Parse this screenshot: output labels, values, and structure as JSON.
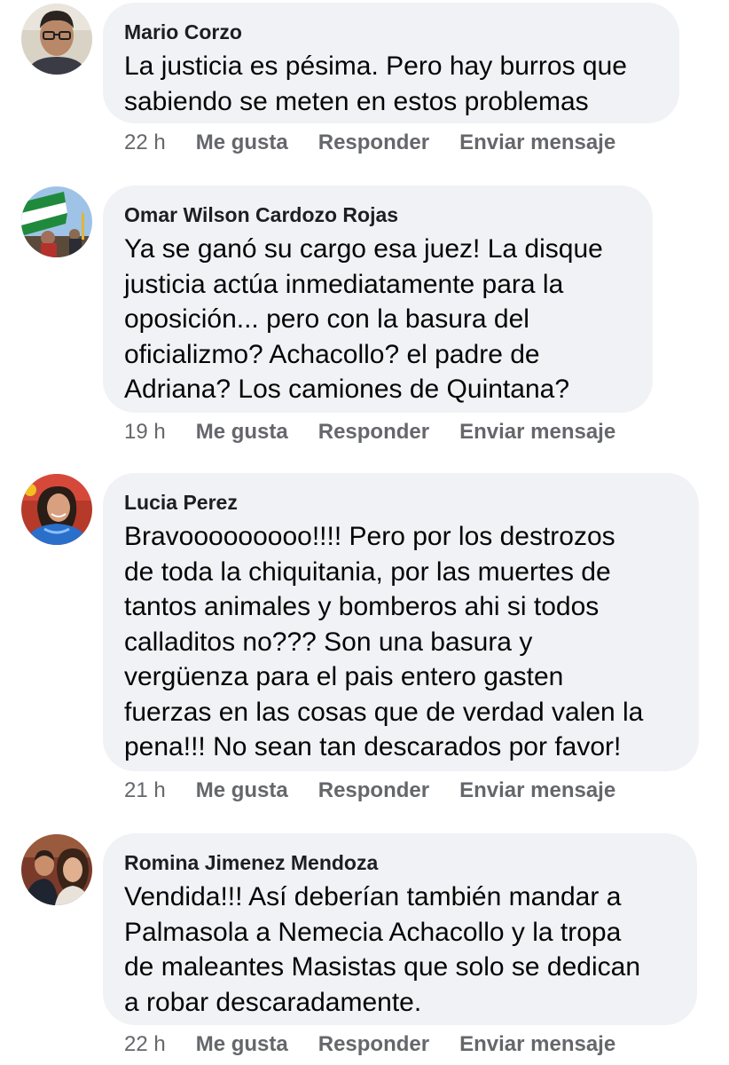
{
  "comments": [
    {
      "author": "Mario Corzo",
      "text": "La justicia es pésima. Pero hay burros que\nsabiendo se meten en estos problemas",
      "time": "22 h",
      "like_label": "Me gusta",
      "reply_label": "Responder",
      "message_label": "Enviar mensaje",
      "avatar_icon": "user-avatar-icon"
    },
    {
      "author": "Omar Wilson Cardozo Rojas",
      "text": "Ya se ganó su cargo esa juez! La disque\njusticia actúa inmediatamente para la\noposición... pero con la basura del\noficializmo? Achacollo? el padre de\nAdriana?  Los camiones de Quintana?",
      "time": "19 h",
      "like_label": "Me gusta",
      "reply_label": "Responder",
      "message_label": "Enviar mensaje",
      "avatar_icon": "user-avatar-icon"
    },
    {
      "author": "Lucia Perez",
      "text": "Bravooooooooo!!!! Pero por los destrozos\nde toda la chiquitania, por las muertes de\ntantos animales y bomberos ahi si todos\ncalladitos no??? Son una basura y\nvergüenza para el pais entero gasten\nfuerzas en las cosas que de verdad valen la\npena!!! No sean tan descarados por favor!",
      "time": "21 h",
      "like_label": "Me gusta",
      "reply_label": "Responder",
      "message_label": "Enviar mensaje",
      "avatar_icon": "user-avatar-icon"
    },
    {
      "author": "Romina Jimenez Mendoza",
      "text": "Vendida!!! Así deberían también mandar a\nPalmasola a Nemecia Achacollo y la tropa\nde maleantes Masistas que solo se dedican\na robar descaradamente.",
      "time": "22 h",
      "like_label": "Me gusta",
      "reply_label": "Responder",
      "message_label": "Enviar mensaje",
      "avatar_icon": "user-avatar-icon"
    }
  ]
}
